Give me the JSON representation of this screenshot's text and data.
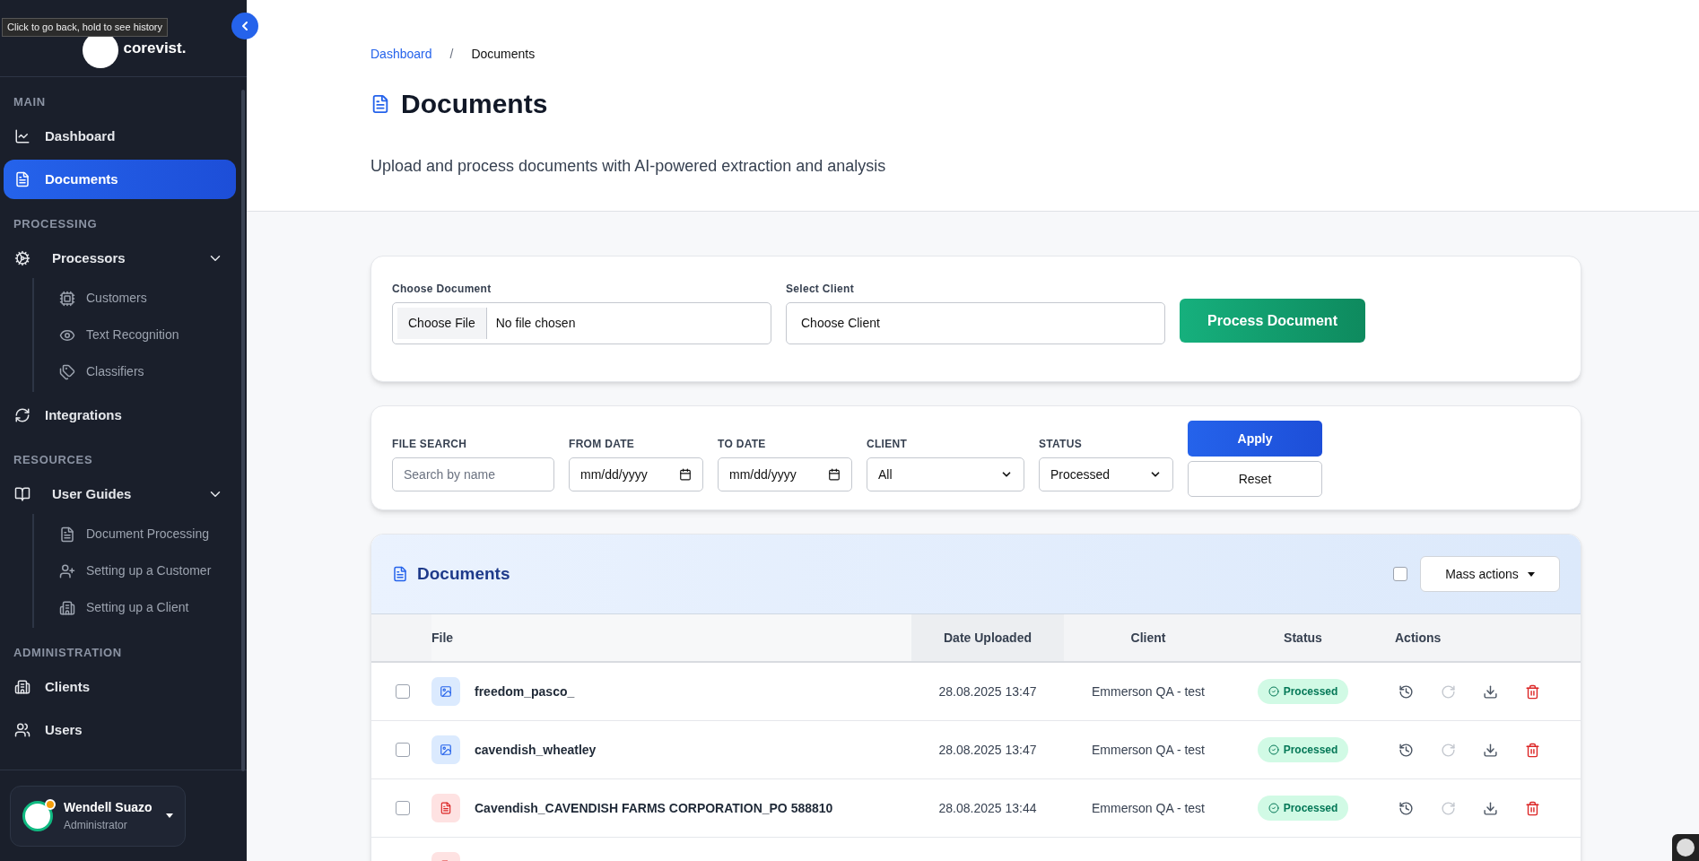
{
  "tooltip": "Click to go back, hold to see history",
  "sidebar": {
    "logo": "corevist.",
    "sections": [
      {
        "title": "MAIN",
        "items": [
          {
            "label": "Dashboard",
            "selected": false
          },
          {
            "label": "Documents",
            "selected": true
          }
        ]
      },
      {
        "title": "PROCESSING",
        "items": [
          {
            "label": "Processors",
            "selected": false,
            "expanded": true,
            "children": [
              {
                "label": "Customers",
                "selected": false
              },
              {
                "label": "Text Recognition",
                "selected": false
              },
              {
                "label": "Classifiers",
                "selected": false
              }
            ]
          },
          {
            "label": "Integrations",
            "selected": false
          }
        ]
      },
      {
        "title": "RESOURCES",
        "items": [
          {
            "label": "User Guides",
            "selected": false,
            "expanded": true,
            "children": [
              {
                "label": "Document Processing",
                "selected": false
              },
              {
                "label": "Setting up a Customer",
                "selected": false
              },
              {
                "label": "Setting up a Client",
                "selected": false
              }
            ]
          }
        ]
      },
      {
        "title": "ADMINISTRATION",
        "items": [
          {
            "label": "Clients",
            "selected": false
          },
          {
            "label": "Users",
            "selected": false
          }
        ]
      }
    ],
    "user": {
      "name": "Wendell Suazo",
      "role": "Administrator"
    }
  },
  "breadcrumb": [
    "Dashboard",
    "Documents"
  ],
  "breadcrumb_separator": "/",
  "page": {
    "title": "Documents",
    "subtitle": "Upload and process documents with AI-powered extraction and analysis"
  },
  "upload": {
    "document_label": "Choose Document",
    "file_button": "Choose File",
    "file_value": "No file chosen",
    "client_label": "Select Client",
    "client_value": "Choose Client",
    "submit": "Process Document"
  },
  "filters": {
    "file_search": {
      "label": "FILE SEARCH",
      "placeholder": "Search by name"
    },
    "from_date": {
      "label": "FROM DATE",
      "value": "mm/dd/yyyy"
    },
    "to_date": {
      "label": "TO DATE",
      "value": "mm/dd/yyyy"
    },
    "client": {
      "label": "CLIENT",
      "value": "All"
    },
    "status": {
      "label": "STATUS",
      "value": "Processed"
    },
    "apply": "Apply",
    "reset": "Reset"
  },
  "table": {
    "title": "Documents",
    "select_all": false,
    "mass_actions": "Mass actions",
    "columns": [
      "File",
      "Date Uploaded",
      "Client",
      "Status",
      "Actions"
    ],
    "rows": [
      {
        "checked": false,
        "kind": "image",
        "file": "freedom_pasco_",
        "date": "28.08.2025 13:47",
        "client": "Emmerson QA - test",
        "status": "Processed",
        "color": "#d1fae5",
        "retry_disabled": true
      },
      {
        "checked": false,
        "kind": "image",
        "file": "cavendish_wheatley",
        "date": "28.08.2025 13:47",
        "client": "Emmerson QA - test",
        "status": "Processed",
        "color": "#d1fae5",
        "retry_disabled": true
      },
      {
        "checked": false,
        "kind": "pdf",
        "file": "Cavendish_CAVENDISH FARMS CORPORATION_PO 588810",
        "date": "28.08.2025 13:44",
        "client": "Emmerson QA - test",
        "status": "Processed",
        "color": "#d1fae5",
        "retry_disabled": true
      },
      {
        "kind": "pdf"
      }
    ]
  }
}
